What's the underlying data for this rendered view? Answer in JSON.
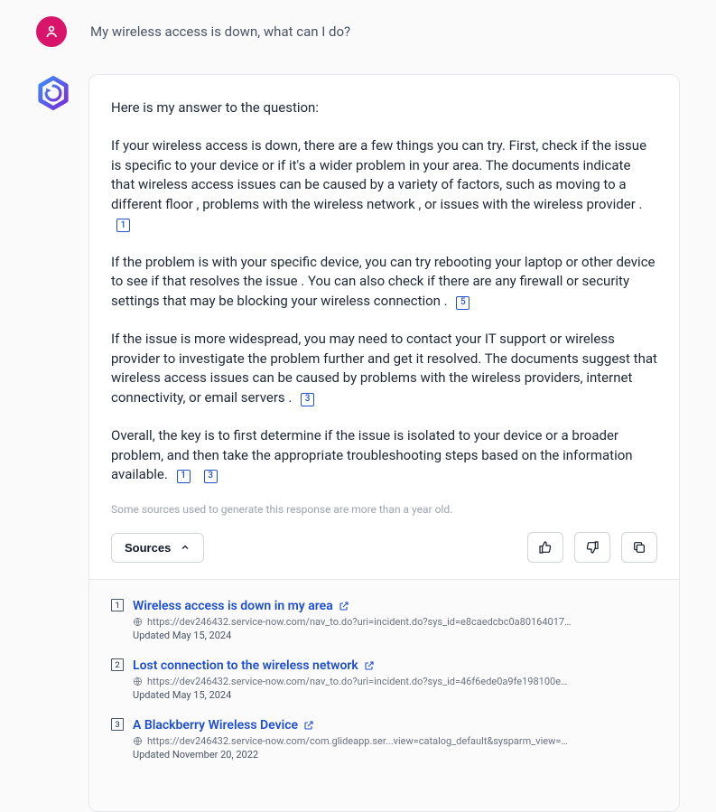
{
  "user": {
    "question": "My wireless access is down, what can I do?"
  },
  "answer": {
    "intro": "Here is my answer to the question:",
    "para1_text": "If your wireless access is down, there are a few things you can try. First, check if the issue is specific to your device or if it's a wider problem in your area. The documents indicate that wireless access issues can be caused by a variety of factors, such as moving to a different floor , problems with the wireless network , or issues with the wireless provider .",
    "para1_cites": [
      "1"
    ],
    "para2_a": "If the problem is with your specific device, you can try rebooting your laptop or other device to see if that resolves the issue .   You can also check if there are any firewall or security settings that may be blocking your wireless connection .",
    "para2_cites": [
      "5"
    ],
    "para3_text": "If the issue is more widespread, you may need to contact your IT support or wireless provider to investigate the problem further and get it resolved. The documents suggest that wireless access issues can be caused by problems with the wireless providers, internet connectivity, or email servers .",
    "para3_cites": [
      "3"
    ],
    "para4_text": "Overall, the key is to first determine if the issue is isolated to your device or a broader problem, and then take the appropriate troubleshooting steps based on the information available.",
    "para4_cites": [
      "1",
      "3"
    ],
    "sources_note": "Some sources used to generate this response are more than a year old.",
    "sources_button": "Sources"
  },
  "sources": [
    {
      "num": "1",
      "title": "Wireless access is down in my area",
      "url": "https://dev246432.service-now.com/nav_to.do?uri=incident.do?sys_id=e8caedcbc0a80164017df472f39eaed1",
      "updated": "Updated May 15, 2024"
    },
    {
      "num": "2",
      "title": "Lost connection to the wireless network",
      "url": "https://dev246432.service-now.com/nav_to.do?uri=incident.do?sys_id=46f6ede0a9fe198100e10154c34a0c2a",
      "updated": "Updated May 15, 2024"
    },
    {
      "num": "3",
      "title": "A Blackberry Wireless Device",
      "url": "https://dev246432.service-now.com/com.glideapp.ser...view=catalog_default&sysparm_view=catalogs_default",
      "updated": "Updated November 20, 2022"
    }
  ]
}
